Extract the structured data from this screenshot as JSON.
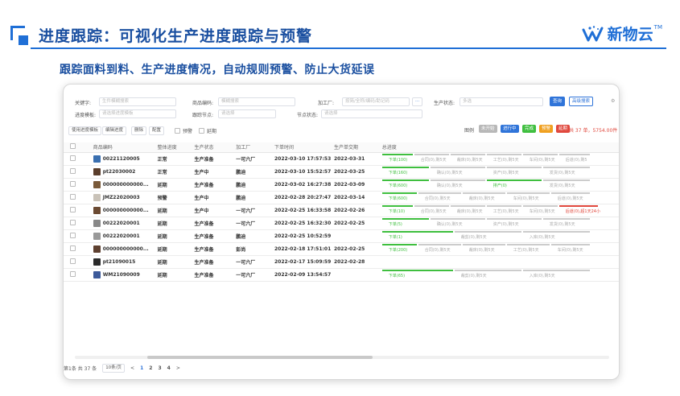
{
  "slide": {
    "title": "进度跟踪：可视化生产进度跟踪与预警",
    "subtitle": "跟踪面料到料、生产进度情况，自动规则预警、防止大货延误",
    "logo_text": "新物云",
    "logo_tm": "TM",
    "accent": "#1f6fd6"
  },
  "filters": {
    "keyword_label": "关键字:",
    "keyword_placeholder": "生件模糊搜索",
    "product_code_label": "商品编码:",
    "product_code_placeholder": "模糊搜索",
    "factory_label": "加工厂:",
    "factory_placeholder": "按简/全称/编码/助记码",
    "more_btn": "···",
    "prod_status_label": "生产状态:",
    "prod_status_placeholder": "多选",
    "search_btn": "查询",
    "advanced_btn": "高级搜索",
    "template_label": "进度模板:",
    "template_placeholder": "请选择进度模板",
    "track_node_label": "跟踪节点:",
    "track_node_placeholder": "请选择",
    "node_status_label": "节点状态:",
    "node_status_placeholder": "请选择"
  },
  "toolbar": {
    "use_template": "使用进度模板",
    "edit_progress": "编辑进度",
    "delete": "删除",
    "config": "配置",
    "warning": "预警",
    "delay": "延期"
  },
  "legend": {
    "label": "图例",
    "items": [
      {
        "text": "未开始",
        "color": "#b8b8b8"
      },
      {
        "text": "进行中",
        "color": "#2f74d9"
      },
      {
        "text": "完成",
        "color": "#3fbf3f"
      },
      {
        "text": "预警",
        "color": "#f0a020"
      },
      {
        "text": "延期",
        "color": "#e0483d"
      }
    ],
    "total": "共 37 单，5754.00件"
  },
  "table": {
    "headers": [
      "商品编码",
      "整体进度",
      "生产状态",
      "加工厂",
      "下单时间",
      "生产单交期",
      "总进度"
    ],
    "rows": [
      {
        "code": "00221120005",
        "overall": "正常",
        "overall_cls": "",
        "status": "生产准备",
        "factory": "一可六厂",
        "order_time": "2022-03-10 17:57:53",
        "due": "2022-03-31",
        "thumb": "#3a6fb0",
        "prog": [
          {
            "w": 40,
            "c": "#3fbf3f",
            "t": "下单(100)",
            "tc": "#3fbf3f"
          },
          {
            "w": 45,
            "c": "#ccc",
            "t": "合同(0),剩5天",
            "tc": "#aaa"
          },
          {
            "w": 45,
            "c": "#ccc",
            "t": "裁床(0),剩5天",
            "tc": "#aaa"
          },
          {
            "w": 45,
            "c": "#ccc",
            "t": "工艺(0),剩5天",
            "tc": "#aaa"
          },
          {
            "w": 45,
            "c": "#ccc",
            "t": "车间(0),剩5天",
            "tc": "#aaa"
          },
          {
            "w": 40,
            "c": "#ccc",
            "t": "后道(0),剩5",
            "tc": "#aaa"
          }
        ]
      },
      {
        "code": "pt22030002",
        "overall": "正常",
        "overall_cls": "",
        "status": "生产中",
        "factory": "鹏迪",
        "order_time": "2022-03-10 15:52:57",
        "due": "2022-03-25",
        "thumb": "#5a3d2b",
        "prog": [
          {
            "w": 60,
            "c": "#3fbf3f",
            "t": "下单(160)",
            "tc": "#3fbf3f"
          },
          {
            "w": 70,
            "c": "#ccc",
            "t": "确认(0),剩5天",
            "tc": "#aaa"
          },
          {
            "w": 70,
            "c": "#ccc",
            "t": "资产(0),剩5天",
            "tc": "#aaa"
          },
          {
            "w": 60,
            "c": "#ccc",
            "t": "发货(0),剩5天",
            "tc": "#aaa"
          }
        ]
      },
      {
        "code": "000000000000...",
        "overall": "延期",
        "overall_cls": "st-red",
        "status": "生产准备",
        "factory": "鹏迪",
        "order_time": "2022-03-02 16:27:38",
        "due": "2022-03-09",
        "thumb": "#7a5a3a",
        "prog": [
          {
            "w": 60,
            "c": "#3fbf3f",
            "t": "下单(600)",
            "tc": "#3fbf3f"
          },
          {
            "w": 70,
            "c": "#ccc",
            "t": "确认(0),剩5天",
            "tc": "#aaa"
          },
          {
            "w": 70,
            "c": "#3fbf3f",
            "t": "排产(0)",
            "tc": "#3fbf3f"
          },
          {
            "w": 60,
            "c": "#ccc",
            "t": "发货(0),剩5天",
            "tc": "#aaa"
          }
        ]
      },
      {
        "code": "JMZ22020003",
        "overall": "预警",
        "overall_cls": "st-org",
        "status": "生产中",
        "factory": "鹏迪",
        "order_time": "2022-02-28 20:27:47",
        "due": "2022-03-14",
        "thumb": "#c9c2b8",
        "prog": [
          {
            "w": 45,
            "c": "#3fbf3f",
            "t": "下单(600)",
            "tc": "#3fbf3f"
          },
          {
            "w": 55,
            "c": "#ccc",
            "t": "合同(0),剩5天",
            "tc": "#aaa"
          },
          {
            "w": 55,
            "c": "#ccc",
            "t": "裁床(0),剩5天",
            "tc": "#aaa"
          },
          {
            "w": 55,
            "c": "#ccc",
            "t": "车间(0),剩5天",
            "tc": "#aaa"
          },
          {
            "w": 50,
            "c": "#ccc",
            "t": "后道(0),剩5天",
            "tc": "#aaa"
          }
        ]
      },
      {
        "code": "000000000000...",
        "overall": "延期",
        "overall_cls": "st-red",
        "status": "生产中",
        "factory": "一可六厂",
        "order_time": "2022-02-25 16:33:58",
        "due": "2022-02-26",
        "thumb": "#6b4a32",
        "prog": [
          {
            "w": 40,
            "c": "#3fbf3f",
            "t": "下单(10)",
            "tc": "#3fbf3f"
          },
          {
            "w": 45,
            "c": "#ccc",
            "t": "合同(0),剩5天",
            "tc": "#aaa"
          },
          {
            "w": 45,
            "c": "#ccc",
            "t": "裁床(0),剩5天",
            "tc": "#aaa"
          },
          {
            "w": 45,
            "c": "#ccc",
            "t": "工艺(0),剩5天",
            "tc": "#aaa"
          },
          {
            "w": 45,
            "c": "#ccc",
            "t": "车间(0),剩5天",
            "tc": "#aaa"
          },
          {
            "w": 50,
            "c": "#e0483d",
            "t": "后道(0),超1天24小",
            "tc": "#e0483d"
          }
        ]
      },
      {
        "code": "00222020001",
        "overall": "延期",
        "overall_cls": "st-red",
        "status": "生产准备",
        "factory": "一可六厂",
        "order_time": "2022-02-25 16:32:30",
        "due": "2022-02-25",
        "thumb": "#888",
        "prog": [
          {
            "w": 60,
            "c": "#3fbf3f",
            "t": "下单(5)",
            "tc": "#3fbf3f"
          },
          {
            "w": 70,
            "c": "#ccc",
            "t": "确认(0),剩5天",
            "tc": "#aaa"
          },
          {
            "w": 70,
            "c": "#ccc",
            "t": "资产(0),剩5天",
            "tc": "#aaa"
          },
          {
            "w": 60,
            "c": "#ccc",
            "t": "发货(0),剩5天",
            "tc": "#aaa"
          }
        ]
      },
      {
        "code": "00222020001",
        "overall": "延期",
        "overall_cls": "st-red",
        "status": "生产准备",
        "factory": "鹏迪",
        "order_time": "2022-02-25 10:52:59",
        "due": "",
        "thumb": "#999",
        "prog": [
          {
            "w": 90,
            "c": "#3fbf3f",
            "t": "下单(1)",
            "tc": "#3fbf3f"
          },
          {
            "w": 85,
            "c": "#ccc",
            "t": "裁剪(0),剩5天",
            "tc": "#aaa"
          },
          {
            "w": 85,
            "c": "#ccc",
            "t": "入库(0),剩5天",
            "tc": "#aaa"
          }
        ]
      },
      {
        "code": "000000000000...",
        "overall": "延期",
        "overall_cls": "st-red",
        "status": "生产准备",
        "factory": "彭尚",
        "order_time": "2022-02-18 17:51:01",
        "due": "2022-02-25",
        "thumb": "#5e4030",
        "prog": [
          {
            "w": 45,
            "c": "#3fbf3f",
            "t": "下单(200)",
            "tc": "#3fbf3f"
          },
          {
            "w": 55,
            "c": "#ccc",
            "t": "合同(0),剩5天",
            "tc": "#aaa"
          },
          {
            "w": 55,
            "c": "#ccc",
            "t": "裁床(0),剩5天",
            "tc": "#aaa"
          },
          {
            "w": 55,
            "c": "#ccc",
            "t": "工艺(0),剩5天",
            "tc": "#aaa"
          },
          {
            "w": 50,
            "c": "#ccc",
            "t": "车间(0),剩5天",
            "tc": "#aaa"
          }
        ]
      },
      {
        "code": "pt21090015",
        "overall": "延期",
        "overall_cls": "st-red",
        "status": "生产准备",
        "factory": "一可六厂",
        "order_time": "2022-02-17 15:09:59",
        "due": "2022-02-28",
        "thumb": "#2b2b2b",
        "prog": []
      },
      {
        "code": "WM21090009",
        "overall": "延期",
        "overall_cls": "st-red",
        "status": "生产准备",
        "factory": "一可六厂",
        "order_time": "2022-02-09 13:54:57",
        "due": "",
        "thumb": "#3d5a9a",
        "prog": [
          {
            "w": 90,
            "c": "#3fbf3f",
            "t": "下单(65)",
            "tc": "#3fbf3f"
          },
          {
            "w": 85,
            "c": "#ccc",
            "t": "裁剪(0),剩5天",
            "tc": "#aaa"
          },
          {
            "w": 85,
            "c": "#ccc",
            "t": "入库(0),剩5天",
            "tc": "#aaa"
          }
        ]
      }
    ]
  },
  "pager": {
    "prefix": "第1条  共 37 条",
    "page_size": "10条/页",
    "pages": [
      "1",
      "2",
      "3",
      "4"
    ],
    "active": "1",
    "prev": "<",
    "next": ">"
  }
}
